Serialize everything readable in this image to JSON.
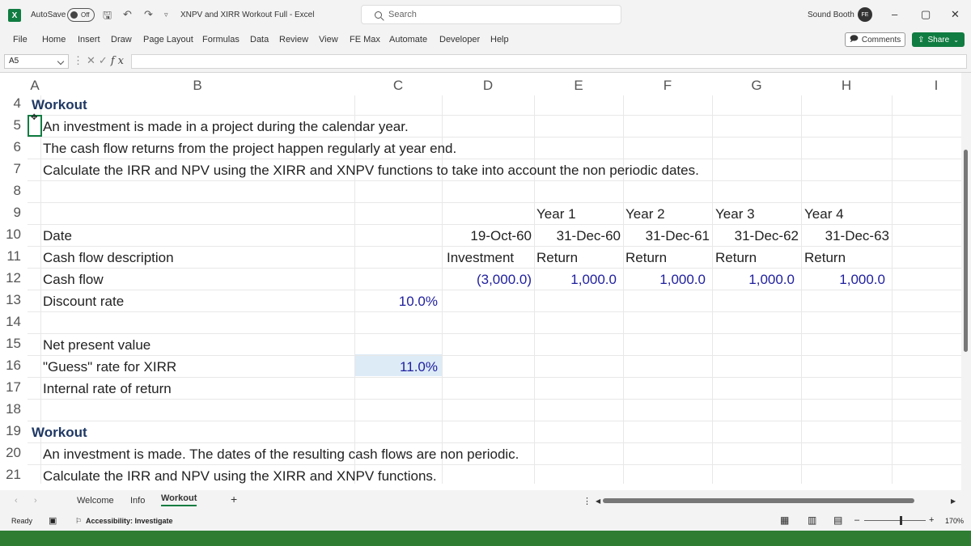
{
  "window": {
    "autosave_label": "AutoSave",
    "autosave_state": "Off",
    "document_title": "XNPV and XIRR Workout Full  -  Excel",
    "search_placeholder": "Search",
    "user_name": "Sound Booth",
    "user_initials": "FE",
    "minimize": "–",
    "restore": "▢",
    "close": "✕"
  },
  "menu": {
    "items": [
      "File",
      "Home",
      "Insert",
      "Draw",
      "Page Layout",
      "Formulas",
      "Data",
      "Review",
      "View",
      "FE Max",
      "Automate",
      "Developer",
      "Help"
    ],
    "comments_label": "Comments",
    "share_label": "Share"
  },
  "formula_bar": {
    "name_box": "A5",
    "fx": "fx",
    "formula": ""
  },
  "columns": [
    "A",
    "B",
    "C",
    "D",
    "E",
    "F",
    "G",
    "H",
    "I"
  ],
  "rows": [
    "4",
    "5",
    "6",
    "7",
    "8",
    "9",
    "10",
    "11",
    "12",
    "13",
    "14",
    "15",
    "16",
    "17",
    "18",
    "19",
    "20",
    "21"
  ],
  "cells": {
    "a4": "Workout",
    "b5": "An investment is made in a project during the calendar year.",
    "b6": "The cash flow returns from the project happen regularly at year end.",
    "b7": "Calculate the IRR and NPV using the XIRR and XNPV functions to take into account the non periodic dates.",
    "e9": "Year 1",
    "f9": "Year 2",
    "g9": "Year 3",
    "h9": "Year 4",
    "b10": "Date",
    "d10": "19-Oct-60",
    "e10": "31-Dec-60",
    "f10": "31-Dec-61",
    "g10": "31-Dec-62",
    "h10": "31-Dec-63",
    "b11": "Cash flow description",
    "d11": "Investment",
    "e11": "Return",
    "f11": "Return",
    "g11": "Return",
    "h11": "Return",
    "b12": "Cash flow",
    "d12": "(3,000.0)",
    "e12": "1,000.0",
    "f12": "1,000.0",
    "g12": "1,000.0",
    "h12": "1,000.0",
    "b13": "Discount rate",
    "c13": "10.0%",
    "b15": "Net present value",
    "b16": "\"Guess\" rate for XIRR",
    "c16": "11.0%",
    "b17": "Internal rate of return",
    "a19": "Workout",
    "b20": "An investment is made. The dates of the resulting cash flows are non periodic.",
    "b21": "Calculate the IRR and NPV using the XIRR and XNPV functions."
  },
  "sheets": {
    "tabs": [
      "Welcome",
      "Info",
      "Workout"
    ],
    "active": "Workout",
    "add": "+"
  },
  "status": {
    "ready": "Ready",
    "accessibility": "Accessibility: Investigate",
    "zoom": "170%"
  },
  "colors": {
    "brand": "#107c41",
    "input_blue": "#1f1f9e",
    "heading": "#1f3864",
    "guess_fill": "#ddebf7"
  }
}
